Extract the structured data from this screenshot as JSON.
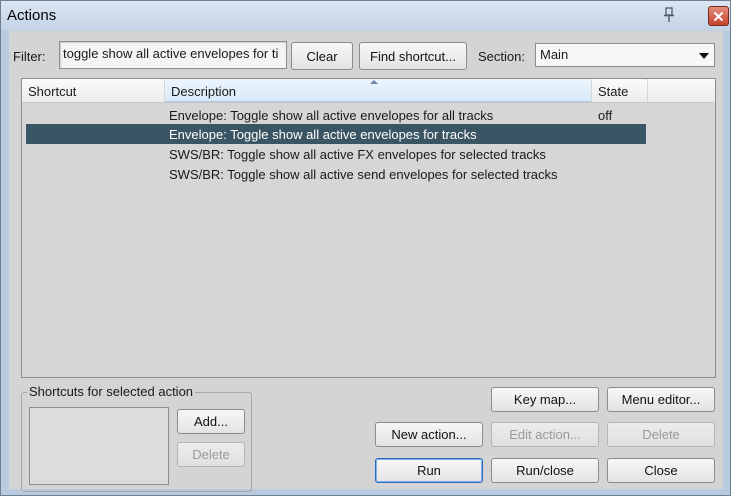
{
  "window": {
    "title": "Actions",
    "pin_icon": "pin-icon",
    "close_icon": "close-icon"
  },
  "filter": {
    "label": "Filter:",
    "value": "toggle show all active envelopes for ti",
    "clear_label": "Clear",
    "find_shortcut_label": "Find shortcut..."
  },
  "section": {
    "label": "Section:",
    "selected": "Main"
  },
  "list": {
    "columns": [
      "Shortcut",
      "Description",
      "State"
    ],
    "sorted_column": "Description",
    "rows": [
      {
        "shortcut": "",
        "description": "Envelope: Toggle show all active envelopes for all tracks",
        "state": "off",
        "selected": false
      },
      {
        "shortcut": "",
        "description": "Envelope: Toggle show all active envelopes for tracks",
        "state": "",
        "selected": true
      },
      {
        "shortcut": "",
        "description": "SWS/BR: Toggle show all active FX envelopes for selected tracks",
        "state": "",
        "selected": false
      },
      {
        "shortcut": "",
        "description": "SWS/BR: Toggle show all active send envelopes for selected tracks",
        "state": "",
        "selected": false
      }
    ]
  },
  "shortcuts_group": {
    "title": "Shortcuts for selected action",
    "add_label": "Add...",
    "delete_label": "Delete"
  },
  "buttons": {
    "key_map": "Key map...",
    "menu_editor": "Menu editor...",
    "new_action": "New action...",
    "edit_action": "Edit action...",
    "delete": "Delete",
    "run": "Run",
    "run_close": "Run/close",
    "close": "Close"
  },
  "colors": {
    "selection": "#3a5563",
    "title_bar": "#c2d2e6",
    "close_button": "#c6432c"
  }
}
